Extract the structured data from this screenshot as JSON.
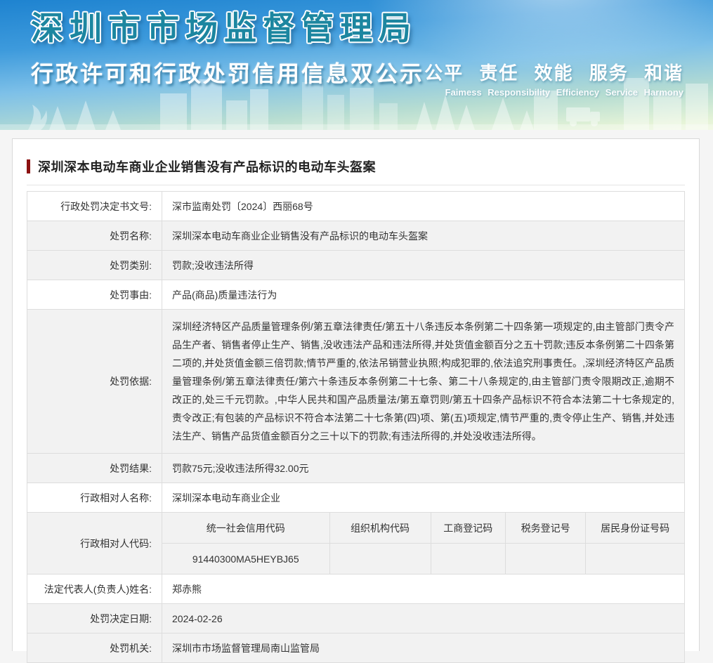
{
  "banner": {
    "agency_title": "深圳市市场监督管理局",
    "subtitle": "行政许可和行政处罚信用信息双公示",
    "slogan_cn": "公平 责任 效能 服务 和谐",
    "slogan_en": "Faimess Responsibility Efficiency Service Harmony"
  },
  "colors": {
    "banner_title_teal": "#1c86a0",
    "title_accent_bar": "#8c1111",
    "row_stripe_gray": "#f2f2f2",
    "table_border": "#dddddd"
  },
  "case": {
    "title": "深圳深本电动车商业企业销售没有产品标识的电动车头盔案"
  },
  "table": {
    "rows": [
      {
        "label": "行政处罚决定书文号:",
        "value": "深市监南处罚〔2024〕西丽68号"
      },
      {
        "label": "处罚名称:",
        "value": "深圳深本电动车商业企业销售没有产品标识的电动车头盔案"
      },
      {
        "label": "处罚类别:",
        "value": "罚款;没收违法所得"
      },
      {
        "label": "处罚事由:",
        "value": "产品(商品)质量违法行为"
      },
      {
        "label": "处罚依据:",
        "value": "深圳经济特区产品质量管理条例/第五章法律责任/第五十八条违反本条例第二十四条第一项规定的,由主管部门责令产品生产者、销售者停止生产、销售,没收违法产品和违法所得,并处货值金额百分之五十罚款;违反本条例第二十四条第二项的,并处货值金额三倍罚款;情节严重的,依法吊销营业执照;构成犯罪的,依法追究刑事责任。,深圳经济特区产品质量管理条例/第五章法律责任/第六十条违反本条例第二十七条、第二十八条规定的,由主管部门责令限期改正,逾期不改正的,处三千元罚款。,中华人民共和国产品质量法/第五章罚则/第五十四条产品标识不符合本法第二十七条规定的,责令改正;有包装的产品标识不符合本法第二十七条第(四)项、第(五)项规定,情节严重的,责令停止生产、销售,并处违法生产、销售产品货值金额百分之三十以下的罚款;有违法所得的,并处没收违法所得。"
      },
      {
        "label": "处罚结果:",
        "value": "罚款75元;没收违法所得32.00元"
      },
      {
        "label": "行政相对人名称:",
        "value": "深圳深本电动车商业企业"
      },
      {
        "label": "法定代表人(负责人)姓名:",
        "value": "郑赤熊"
      },
      {
        "label": "处罚决定日期:",
        "value": "2024-02-26"
      },
      {
        "label": "处罚机关:",
        "value": "深圳市市场监督管理局南山监管局"
      }
    ],
    "codes": {
      "label": "行政相对人代码:",
      "headers": [
        "统一社会信用代码",
        "组织机构代码",
        "工商登记码",
        "税务登记号",
        "居民身份证号码"
      ],
      "values": [
        "91440300MA5HEYBJ65",
        "",
        "",
        "",
        ""
      ]
    }
  }
}
